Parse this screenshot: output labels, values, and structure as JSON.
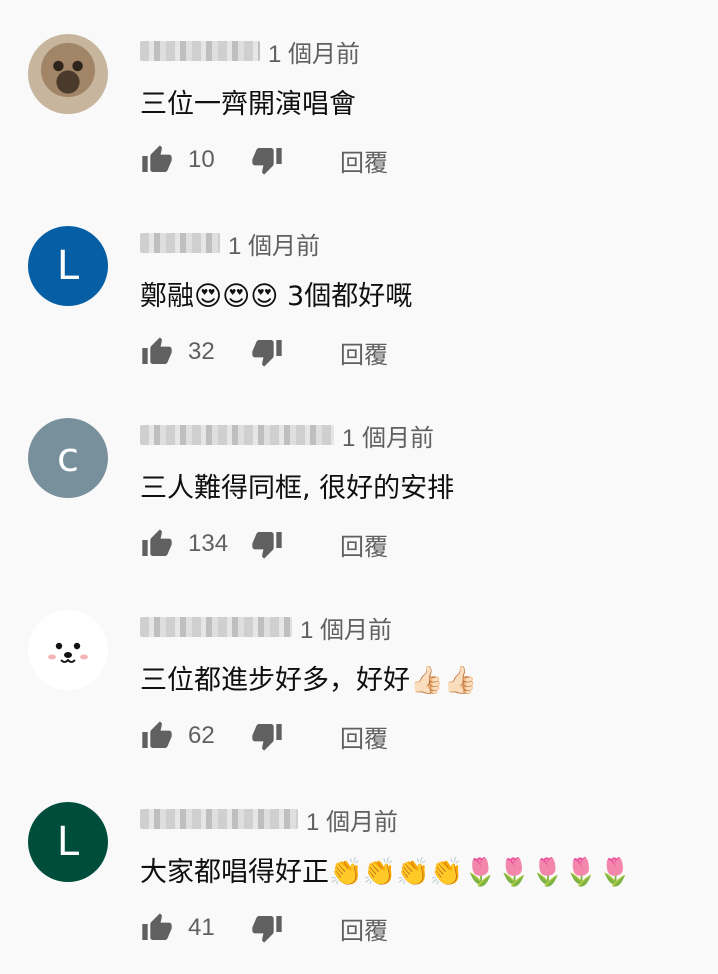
{
  "comments": [
    {
      "avatar": {
        "type": "photo",
        "letter": "",
        "color": "#a28566"
      },
      "time": "1 個月前",
      "text": "三位一齊開演唱會",
      "likes": "10",
      "reply_label": "回覆"
    },
    {
      "avatar": {
        "type": "letter",
        "letter": "L",
        "color": "#065fa5"
      },
      "time": "1 個月前",
      "text": "鄭融😍😍😍 3個都好嘅",
      "likes": "32",
      "reply_label": "回覆"
    },
    {
      "avatar": {
        "type": "letter",
        "letter": "c",
        "color": "#78909c"
      },
      "time": "1 個月前",
      "text": "三人難得同框, 很好的安排",
      "likes": "134",
      "reply_label": "回覆"
    },
    {
      "avatar": {
        "type": "bear",
        "letter": "",
        "color": "#ffffff"
      },
      "time": "1 個月前",
      "text": "三位都進步好多，好好👍🏻👍🏻",
      "likes": "62",
      "reply_label": "回覆"
    },
    {
      "avatar": {
        "type": "letter",
        "letter": "L",
        "color": "#004d3b"
      },
      "time": "1 個月前",
      "text": "大家都唱得好正👏👏👏👏🌷🌷🌷🌷🌷",
      "likes": "41",
      "reply_label": "回覆"
    }
  ],
  "icons": {
    "like": "thumbs-up-icon",
    "dislike": "thumbs-down-icon"
  }
}
